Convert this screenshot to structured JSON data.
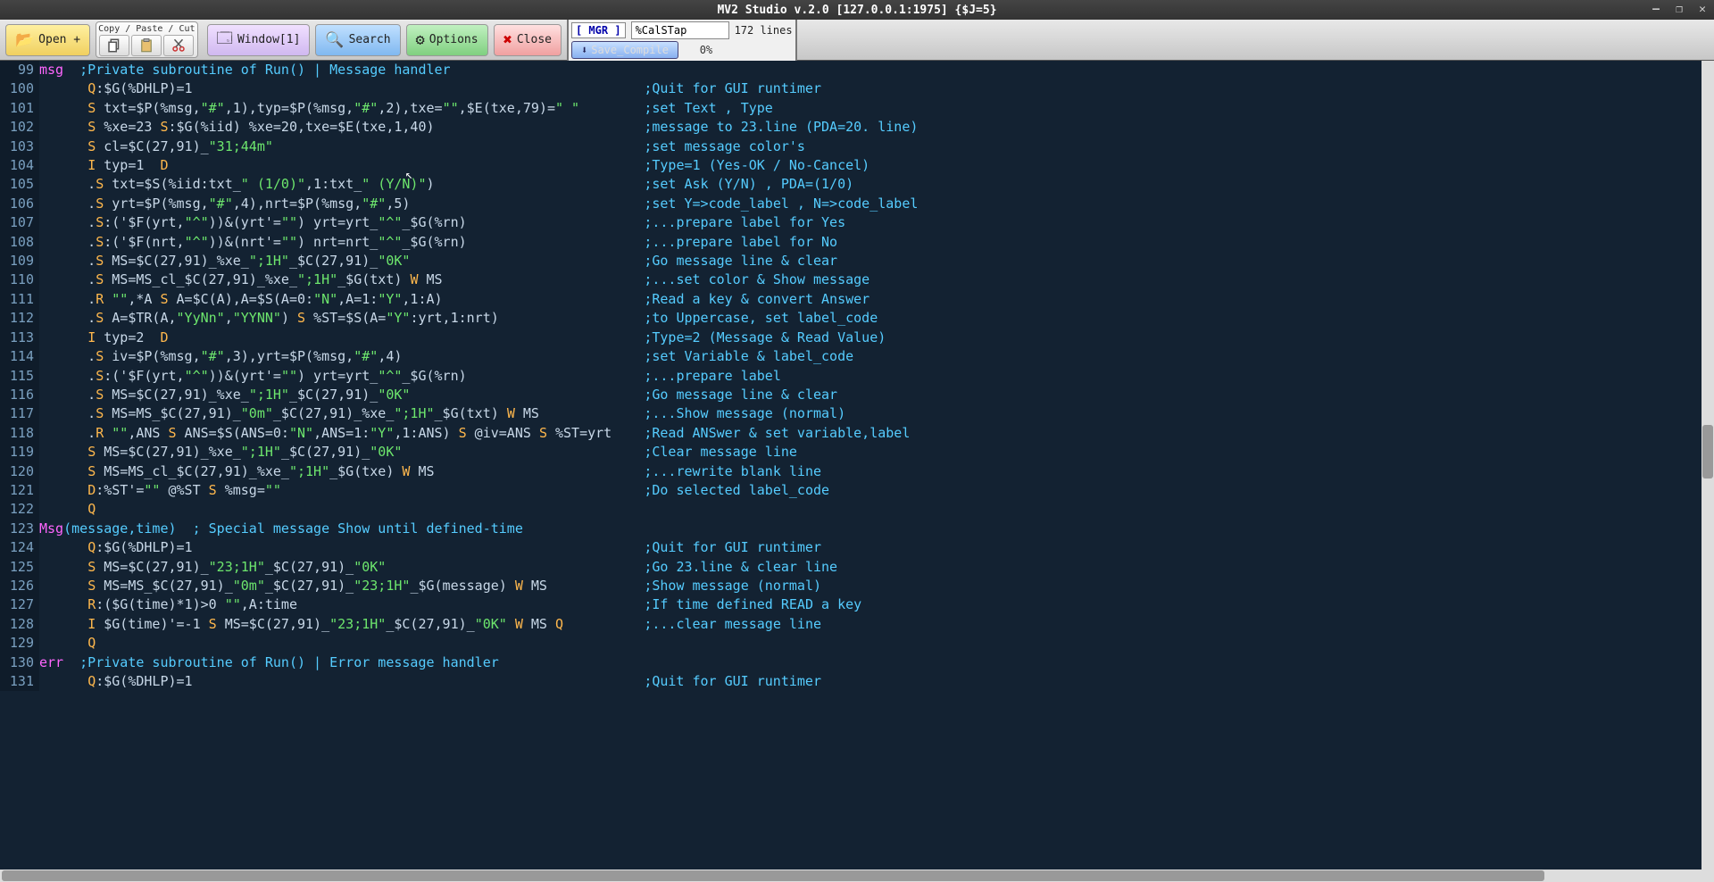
{
  "title": "MV2 Studio v.2.0 [127.0.0.1:1975]  {$J=5}",
  "toolbar": {
    "open": "Open +",
    "cpc_group": "Copy / Paste / Cut",
    "window": "Window[1]",
    "search": "Search",
    "options": "Options",
    "close": "Close",
    "mgr": "[ MGR    ]",
    "routine": "%CalSTap",
    "lines": "172 lines",
    "save_compile": "Save_Compile",
    "pct": "0%"
  },
  "winctl": {
    "min": "—",
    "max": "❐",
    "close": "✕"
  },
  "code": [
    {
      "n": 99,
      "lbl": "msg",
      "txt": "  ;Private subroutine of Run() | Message handler",
      "cmt": ""
    },
    {
      "n": 100,
      "lbl": "",
      "txt": "      Q:$G(%DHLP)=1",
      "cmt": ";Quit for GUI runtimer"
    },
    {
      "n": 101,
      "lbl": "",
      "txt": "      S txt=$P(%msg,\"#\",1),typ=$P(%msg,\"#\",2),txe=\"\",$E(txe,79)=\" \"",
      "cmt": ";set Text , Type"
    },
    {
      "n": 102,
      "lbl": "",
      "txt": "      S %xe=23 S:$G(%iid) %xe=20,txe=$E(txe,1,40)",
      "cmt": ";message to 23.line (PDA=20. line)"
    },
    {
      "n": 103,
      "lbl": "",
      "txt": "      S cl=$C(27,91)_\"31;44m\"",
      "cmt": ";set message color's"
    },
    {
      "n": 104,
      "lbl": "",
      "txt": "      I typ=1  D",
      "cmt": ";Type=1 (Yes-OK / No-Cancel)"
    },
    {
      "n": 105,
      "lbl": "",
      "txt": "      .S txt=$S(%iid:txt_\" (1/0)\",1:txt_\" (Y/N)\")",
      "cmt": ";set Ask (Y/N) , PDA=(1/0)"
    },
    {
      "n": 106,
      "lbl": "",
      "txt": "      .S yrt=$P(%msg,\"#\",4),nrt=$P(%msg,\"#\",5)",
      "cmt": ";set Y=>code_label , N=>code_label"
    },
    {
      "n": 107,
      "lbl": "",
      "txt": "      .S:('$F(yrt,\"^\"))&(yrt'=\"\") yrt=yrt_\"^\"_$G(%rn)",
      "cmt": ";...prepare label for Yes"
    },
    {
      "n": 108,
      "lbl": "",
      "txt": "      .S:('$F(nrt,\"^\"))&(nrt'=\"\") nrt=nrt_\"^\"_$G(%rn)",
      "cmt": ";...prepare label for No"
    },
    {
      "n": 109,
      "lbl": "",
      "txt": "      .S MS=$C(27,91)_%xe_\";1H\"_$C(27,91)_\"0K\"",
      "cmt": ";Go message line & clear"
    },
    {
      "n": 110,
      "lbl": "",
      "txt": "      .S MS=MS_cl_$C(27,91)_%xe_\";1H\"_$G(txt) W MS",
      "cmt": ";...set color & Show message"
    },
    {
      "n": 111,
      "lbl": "",
      "txt": "      .R \"\",*A S A=$C(A),A=$S(A=0:\"N\",A=1:\"Y\",1:A)",
      "cmt": ";Read a key & convert Answer"
    },
    {
      "n": 112,
      "lbl": "",
      "txt": "      .S A=$TR(A,\"YyNn\",\"YYNN\") S %ST=$S(A=\"Y\":yrt,1:nrt)",
      "cmt": ";to Uppercase, set label_code"
    },
    {
      "n": 113,
      "lbl": "",
      "txt": "      I typ=2  D",
      "cmt": ";Type=2 (Message & Read Value)"
    },
    {
      "n": 114,
      "lbl": "",
      "txt": "      .S iv=$P(%msg,\"#\",3),yrt=$P(%msg,\"#\",4)",
      "cmt": ";set Variable & label_code"
    },
    {
      "n": 115,
      "lbl": "",
      "txt": "      .S:('$F(yrt,\"^\"))&(yrt'=\"\") yrt=yrt_\"^\"_$G(%rn)",
      "cmt": ";...prepare label"
    },
    {
      "n": 116,
      "lbl": "",
      "txt": "      .S MS=$C(27,91)_%xe_\";1H\"_$C(27,91)_\"0K\"",
      "cmt": ";Go message line & clear"
    },
    {
      "n": 117,
      "lbl": "",
      "txt": "      .S MS=MS_$C(27,91)_\"0m\"_$C(27,91)_%xe_\";1H\"_$G(txt) W MS",
      "cmt": ";...Show message (normal)"
    },
    {
      "n": 118,
      "lbl": "",
      "txt": "      .R \"\",ANS S ANS=$S(ANS=0:\"N\",ANS=1:\"Y\",1:ANS) S @iv=ANS S %ST=yrt",
      "cmt": ";Read ANSwer & set variable,label"
    },
    {
      "n": 119,
      "lbl": "",
      "txt": "      S MS=$C(27,91)_%xe_\";1H\"_$C(27,91)_\"0K\"",
      "cmt": ";Clear message line"
    },
    {
      "n": 120,
      "lbl": "",
      "txt": "      S MS=MS_cl_$C(27,91)_%xe_\";1H\"_$G(txe) W MS",
      "cmt": ";...rewrite blank line"
    },
    {
      "n": 121,
      "lbl": "",
      "txt": "      D:%ST'=\"\" @%ST S %msg=\"\"",
      "cmt": ";Do selected label_code"
    },
    {
      "n": 122,
      "lbl": "",
      "txt": "      Q",
      "cmt": ""
    },
    {
      "n": 123,
      "lbl": "Msg",
      "txt": "(message,time)  ; Special message Show until defined-time",
      "cmt": ""
    },
    {
      "n": 124,
      "lbl": "",
      "txt": "      Q:$G(%DHLP)=1",
      "cmt": ";Quit for GUI runtimer"
    },
    {
      "n": 125,
      "lbl": "",
      "txt": "      S MS=$C(27,91)_\"23;1H\"_$C(27,91)_\"0K\"",
      "cmt": ";Go 23.line & clear line"
    },
    {
      "n": 126,
      "lbl": "",
      "txt": "      S MS=MS_$C(27,91)_\"0m\"_$C(27,91)_\"23;1H\"_$G(message) W MS",
      "cmt": ";Show message (normal)"
    },
    {
      "n": 127,
      "lbl": "",
      "txt": "      R:($G(time)*1)>0 \"\",A:time",
      "cmt": ";If time defined READ a key"
    },
    {
      "n": 128,
      "lbl": "",
      "txt": "      I $G(time)'=-1 S MS=$C(27,91)_\"23;1H\"_$C(27,91)_\"0K\" W MS Q",
      "cmt": ";...clear message line"
    },
    {
      "n": 129,
      "lbl": "",
      "txt": "      Q",
      "cmt": ""
    },
    {
      "n": 130,
      "lbl": "err",
      "txt": "  ;Private subroutine of Run() | Error message handler",
      "cmt": ""
    },
    {
      "n": 131,
      "lbl": "",
      "txt": "      Q:$G(%DHLP)=1",
      "cmt": ";Quit for GUI runtimer"
    }
  ]
}
